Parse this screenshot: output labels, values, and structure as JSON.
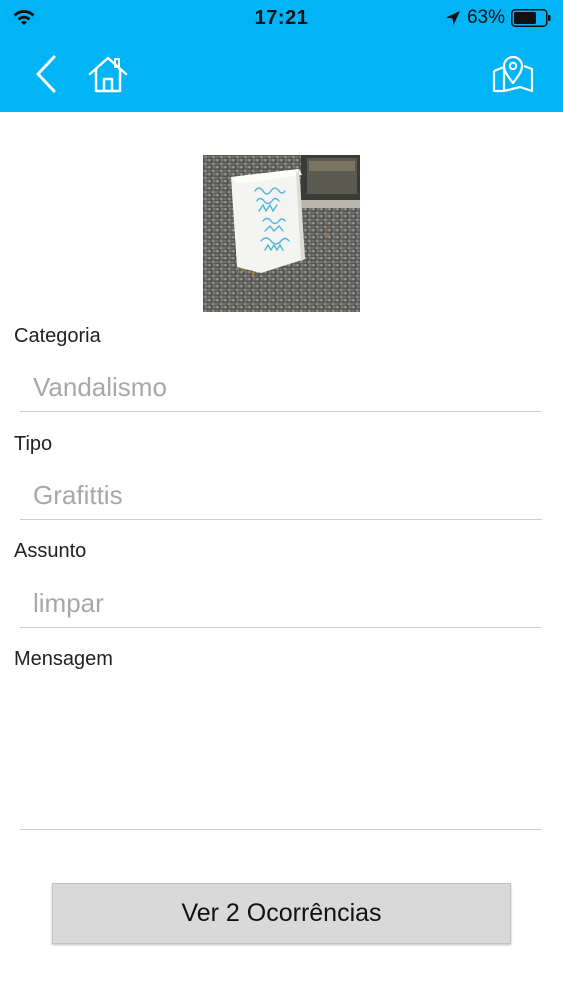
{
  "status_bar": {
    "time": "17:21",
    "battery_percent": "63%",
    "icons": [
      "wifi-icon",
      "location-arrow-icon",
      "battery-icon"
    ]
  },
  "nav_bar": {
    "background_color": "#00b4f5",
    "icons": [
      "back-chevron-icon",
      "home-icon",
      "map-pin-icon"
    ]
  },
  "photo": {
    "graffiti_text": [
      "BAAN",
      "OPPE",
      "IKK",
      "SEE",
      "DONA",
      "MIMA"
    ]
  },
  "form": {
    "categoria": {
      "label": "Categoria",
      "value": "Vandalismo"
    },
    "tipo": {
      "label": "Tipo",
      "value": "Grafittis"
    },
    "assunto": {
      "label": "Assunto",
      "value": "limpar"
    },
    "mensagem": {
      "label": "Mensagem",
      "value": ""
    }
  },
  "button": {
    "label": "Ver 2 Ocorrências"
  }
}
